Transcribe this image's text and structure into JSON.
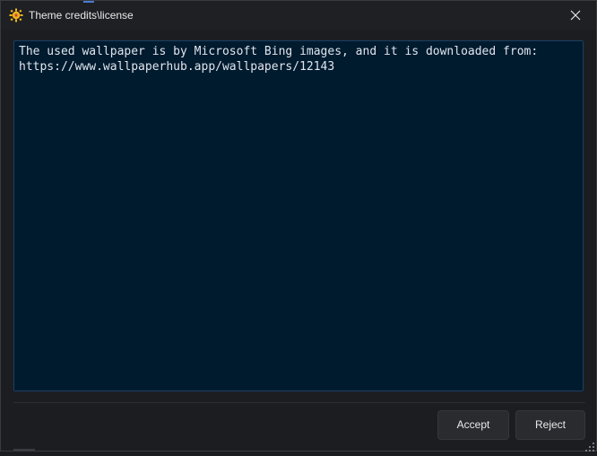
{
  "window": {
    "title": "Theme credits\\license",
    "icon": "sun-gear-icon"
  },
  "content": {
    "text": "The used wallpaper is by Microsoft Bing images, and it is downloaded from:\nhttps://www.wallpaperhub.app/wallpapers/12143"
  },
  "buttons": {
    "accept_label": "Accept",
    "reject_label": "Reject"
  },
  "colors": {
    "text_area_bg": "#001a2e",
    "text_area_border": "#1c3f63",
    "window_bg": "#1c1d21",
    "icon_yellow": "#f5b81c"
  }
}
